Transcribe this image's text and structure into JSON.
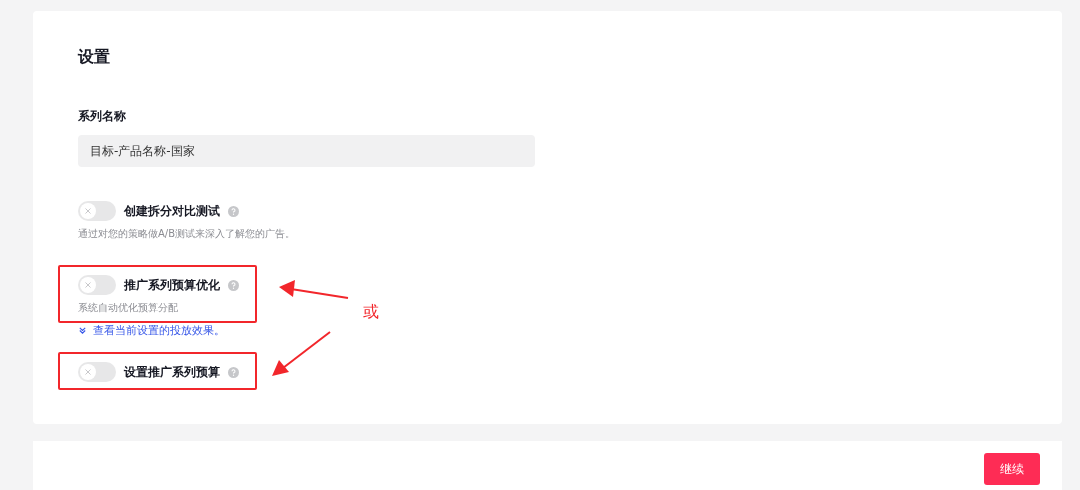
{
  "settings": {
    "title": "设置",
    "name_field": {
      "label": "系列名称",
      "value": "目标-产品名称-国家"
    },
    "toggles": [
      {
        "label": "创建拆分对比测试",
        "on": false,
        "highlighted": false,
        "description": "通过对您的策略做A/B测试来深入了解您的广告。"
      },
      {
        "label": "推广系列预算优化",
        "on": false,
        "highlighted": true,
        "description": "系统自动优化预算分配",
        "link": "查看当前设置的投放效果。"
      },
      {
        "label": "设置推广系列预算",
        "on": false,
        "highlighted": true
      }
    ]
  },
  "annotation": {
    "label": "或"
  },
  "footer": {
    "continue_button": "继续"
  }
}
